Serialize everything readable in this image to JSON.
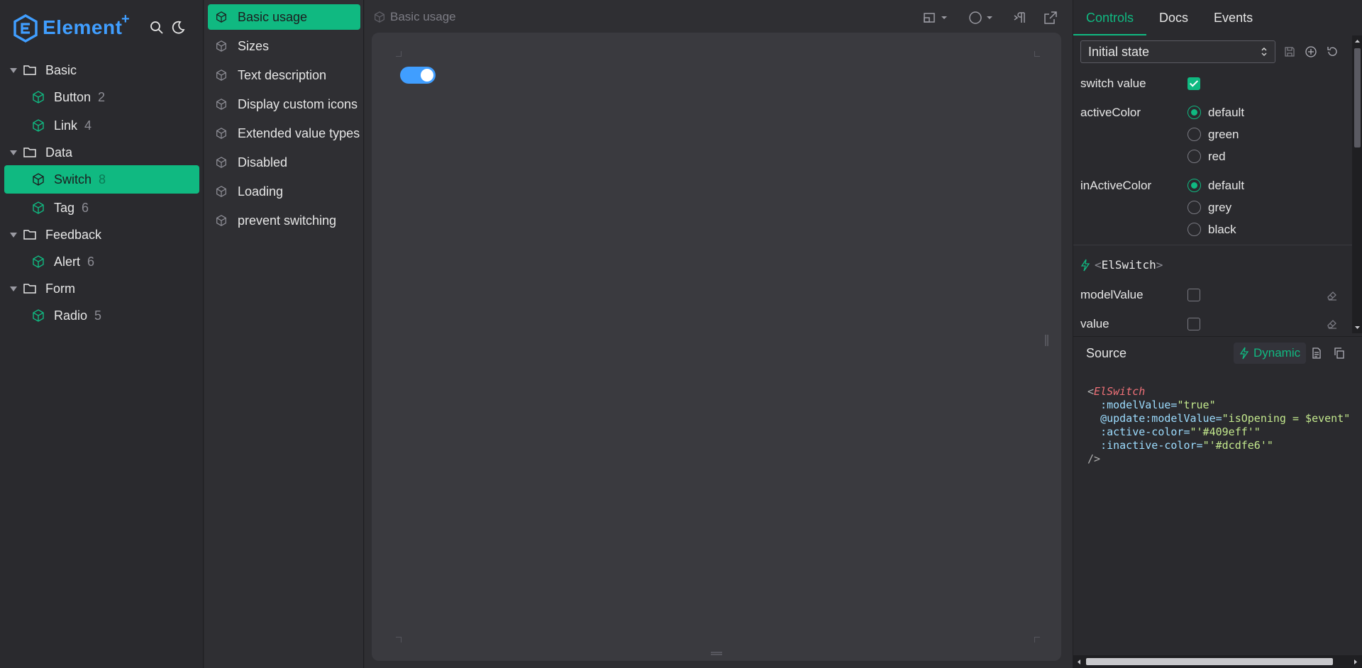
{
  "app": {
    "logo_text": "Element",
    "logo_plus": "+"
  },
  "sidebar": {
    "groups": [
      {
        "label": "Basic",
        "items": [
          {
            "label": "Button",
            "count": "2"
          },
          {
            "label": "Link",
            "count": "4"
          }
        ]
      },
      {
        "label": "Data",
        "items": [
          {
            "label": "Switch",
            "count": "8"
          },
          {
            "label": "Tag",
            "count": "6"
          }
        ]
      },
      {
        "label": "Feedback",
        "items": [
          {
            "label": "Alert",
            "count": "6"
          }
        ]
      },
      {
        "label": "Form",
        "items": [
          {
            "label": "Radio",
            "count": "5"
          }
        ]
      }
    ]
  },
  "stories": {
    "items": [
      "Basic usage",
      "Sizes",
      "Text description",
      "Display custom icons",
      "Extended value types",
      "Disabled",
      "Loading",
      "prevent switching"
    ]
  },
  "preview": {
    "title": "Basic usage",
    "switch_on": true
  },
  "panel": {
    "tabs": [
      "Controls",
      "Docs",
      "Events"
    ],
    "state_select": "Initial state",
    "controls": {
      "switch_value_label": "switch value",
      "active_color_label": "activeColor",
      "active_color_options": [
        "default",
        "green",
        "red"
      ],
      "inactive_color_label": "inActiveColor",
      "inactive_color_options": [
        "default",
        "grey",
        "black"
      ]
    },
    "component": {
      "lt": "<",
      "name": "ElSwitch",
      "gt": ">"
    },
    "props": {
      "model_value_label": "modelValue",
      "value_label": "value"
    },
    "source": {
      "label": "Source",
      "dynamic_label": "Dynamic",
      "code": {
        "open": "<",
        "tag": "ElSwitch",
        "l1_attr": ":modelValue=",
        "l1_val": "\"true\"",
        "l2_attr": "@update:modelValue=",
        "l2_val": "\"isOpening = $event\"",
        "l3_attr": ":active-color=",
        "l3_val": "\"'#409eff'\"",
        "l4_attr": ":inactive-color=",
        "l4_val": "\"'#dcdfe6'\"",
        "close": "/>"
      }
    }
  },
  "colors": {
    "accent": "#10b981",
    "brand": "#409eff"
  }
}
